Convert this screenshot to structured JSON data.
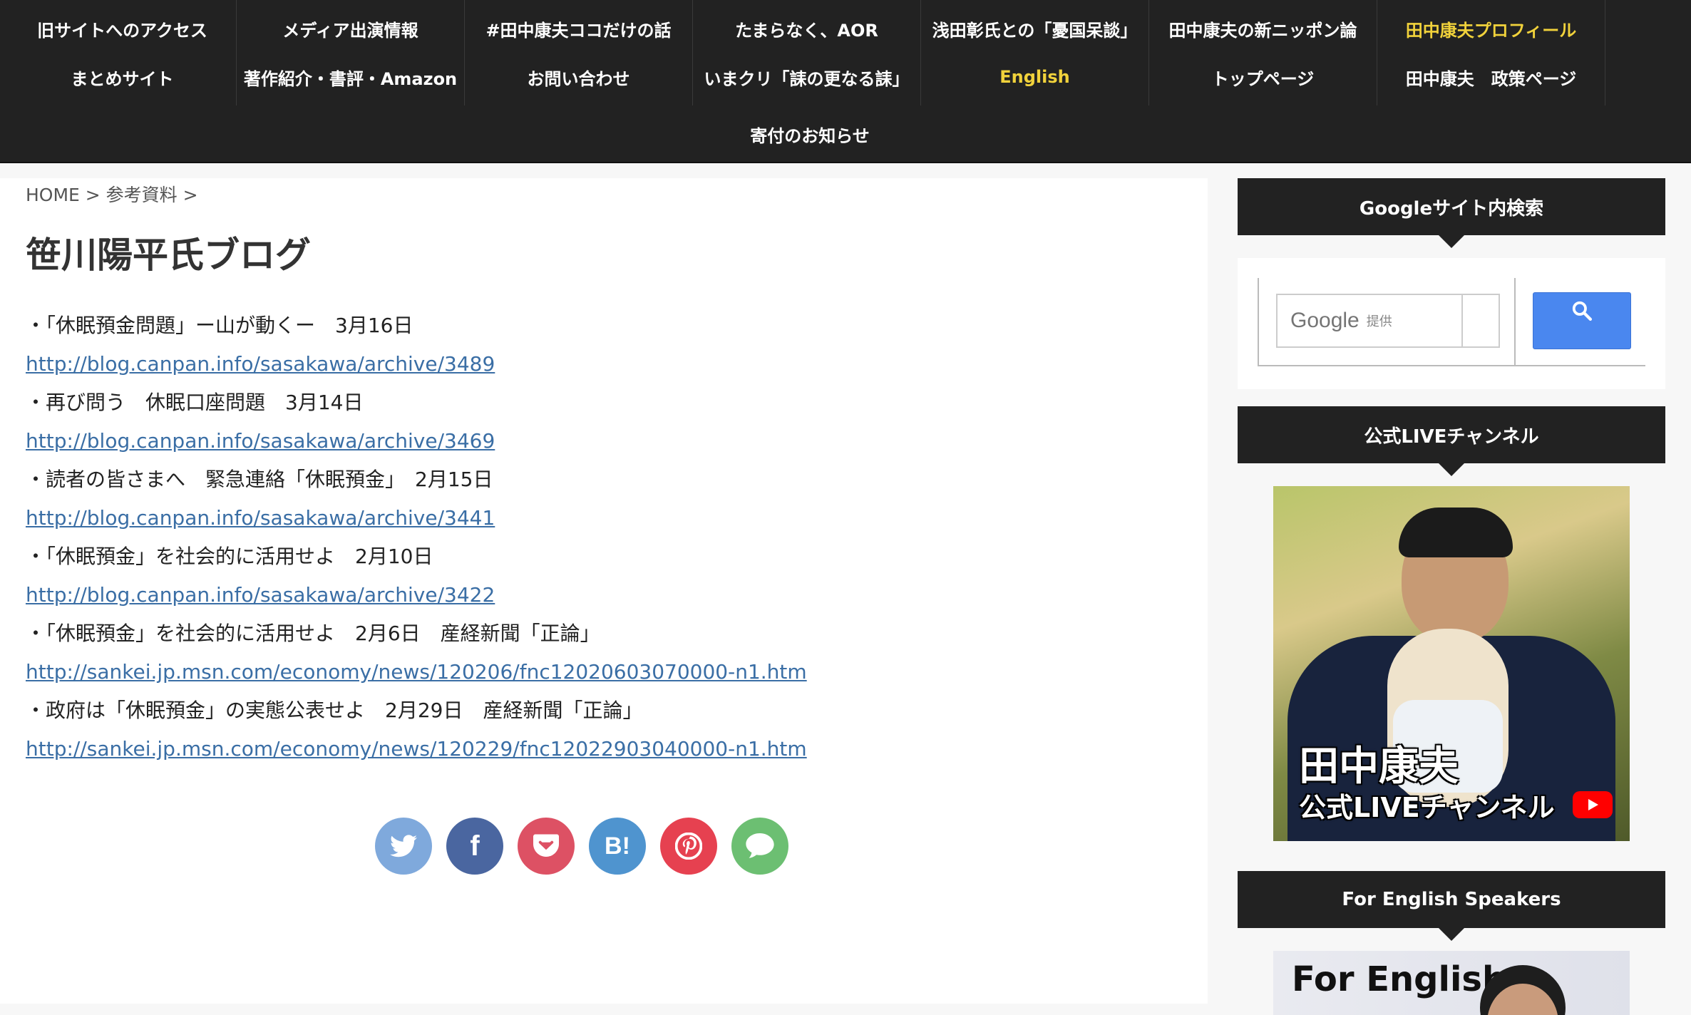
{
  "nav": {
    "row1": [
      "旧サイトへのアクセス",
      "メディア出演情報",
      "#田中康夫ココだけの話",
      "たまらなく、AOR",
      "浅田彰氏との「憂国呆談」",
      "田中康夫の新ニッポン論",
      "田中康夫プロフィール"
    ],
    "row2": [
      "まとめサイト",
      "著作紹介・書評・Amazon",
      "お問い合わせ",
      "いまクリ「誄の更なる誄」",
      "English",
      "トップページ",
      "田中康夫　政策ページ"
    ],
    "row3": [
      "寄付のお知らせ"
    ],
    "highlight_color": "#f1d23b"
  },
  "breadcrumb": "HOME > 参考資料 >",
  "page_title": "笹川陽平氏ブログ",
  "entries": [
    {
      "text": "・「休眠預金問題」ー山が動くー　3月16日",
      "url": "http://blog.canpan.info/sasakawa/archive/3489"
    },
    {
      "text": "・再び問う　休眠口座問題　3月14日",
      "url": "http://blog.canpan.info/sasakawa/archive/3469"
    },
    {
      "text": "・読者の皆さまへ　緊急連絡「休眠預金」　2月15日",
      "url": "http://blog.canpan.info/sasakawa/archive/3441"
    },
    {
      "text": "・「休眠預金」を社会的に活用せよ　2月10日",
      "url": "http://blog.canpan.info/sasakawa/archive/3422"
    },
    {
      "text": "・「休眠預金」を社会的に活用せよ　2月6日　産経新聞「正論」",
      "url": "http://sankei.jp.msn.com/economy/news/120206/fnc12020603070000-n1.htm"
    },
    {
      "text": "・政府は「休眠預金」の実態公表せよ　2月29日　産経新聞「正論」",
      "url": "http://sankei.jp.msn.com/economy/news/120229/fnc12022903040000-n1.htm"
    }
  ],
  "share": [
    {
      "name": "twitter",
      "glyph": "🐦",
      "color": "#7fa9dc"
    },
    {
      "name": "facebook",
      "glyph": "f",
      "color": "#4a66a0"
    },
    {
      "name": "pocket",
      "glyph": "♡",
      "color": "#dd5164"
    },
    {
      "name": "hatena",
      "glyph": "B!",
      "color": "#4f94cf"
    },
    {
      "name": "pinterest",
      "glyph": "P",
      "color": "#e64150"
    },
    {
      "name": "line",
      "glyph": "💬",
      "color": "#6cbf72"
    }
  ],
  "sidebar": {
    "search_title": "Googleサイト内検索",
    "search_placeholder_brand": "Google",
    "search_placeholder_small": "提供",
    "live_title": "公式LIVEチャンネル",
    "live_caption_1": "田中康夫",
    "live_caption_2": "公式LIVEチャンネル",
    "english_title": "For English Speakers",
    "english_image_text": "For English"
  }
}
